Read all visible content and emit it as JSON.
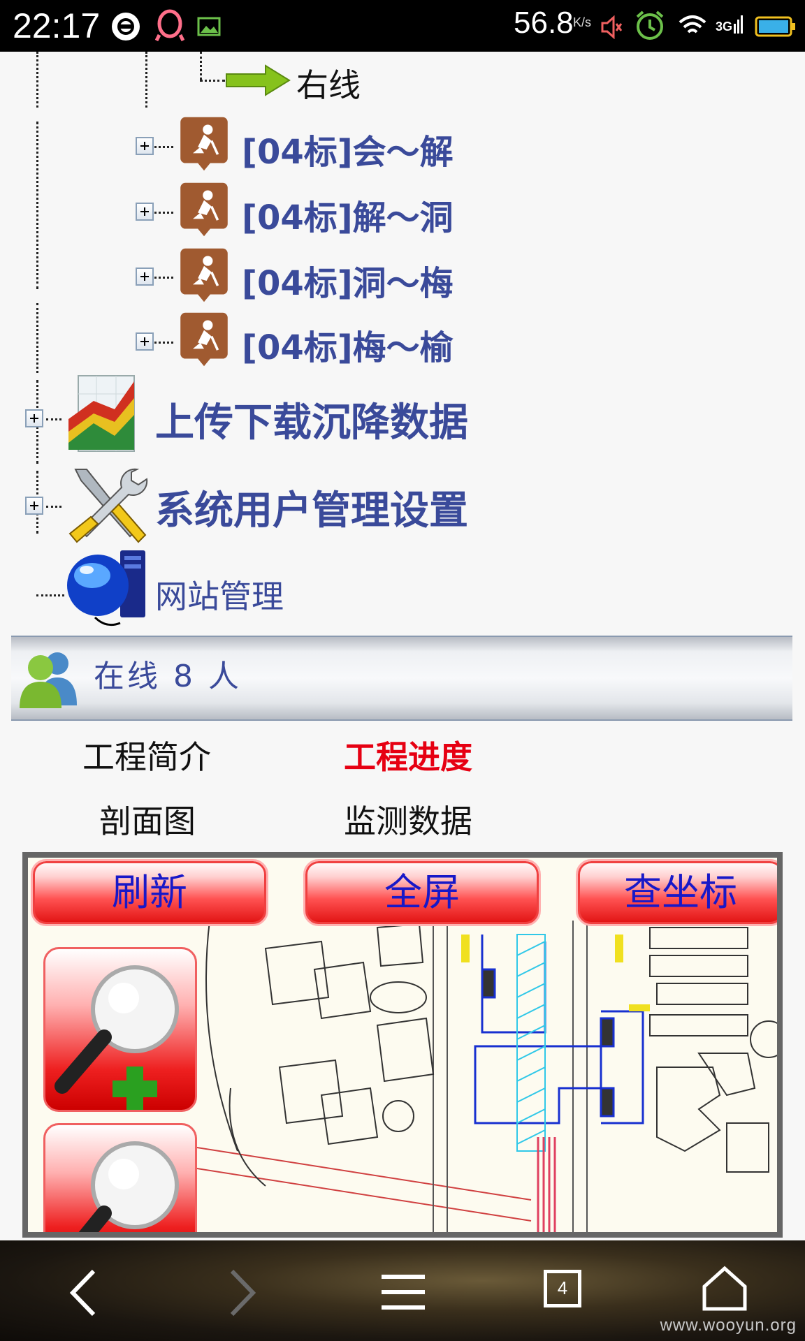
{
  "status_bar": {
    "time": "22:17",
    "net_speed": "56.8",
    "net_speed_unit": "K/s"
  },
  "tree": {
    "right_line_label": "右线",
    "segments": [
      {
        "label": "[04标]会～解"
      },
      {
        "label": "[04标]解～洞"
      },
      {
        "label": "[04标]洞～梅"
      },
      {
        "label": "[04标]梅～榆"
      }
    ],
    "upload_label": "上传下载沉降数据",
    "system_label": "系统用户管理设置",
    "website_label": "网站管理"
  },
  "online": {
    "text": "在线  8 人"
  },
  "links": {
    "intro": "工程简介",
    "progress": "工程进度",
    "section": "剖面图",
    "monitor": "监测数据"
  },
  "map_toolbar": {
    "refresh": "刷新",
    "fullscreen": "全屏",
    "coords": "查坐标"
  },
  "navbar": {
    "tabs_count": "4",
    "watermark": "www.wooyun.org"
  },
  "colors": {
    "tree_label": "#3a4a9a",
    "active_link": "#e60012",
    "button_text": "#1818c8",
    "button_red": "#ee2020"
  }
}
